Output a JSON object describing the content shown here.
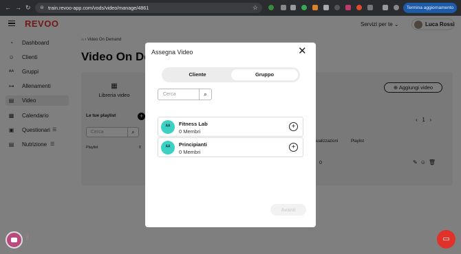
{
  "browser": {
    "url": "train.revoo-app.com/vods/video/manage/4861",
    "update_button": "Termina aggiornamento"
  },
  "header": {
    "logo": "REVOO",
    "services_label": "Servizi per te",
    "user_name": "Luca Rossi"
  },
  "sidebar": {
    "items": [
      {
        "label": "Dashboard",
        "icon": "gauge-icon"
      },
      {
        "label": "Clienti",
        "icon": "person-icon"
      },
      {
        "label": "Gruppi",
        "icon": "group-icon"
      },
      {
        "label": "Allenamenti",
        "icon": "dumbbell-icon"
      },
      {
        "label": "Video",
        "icon": "film-icon",
        "active": true
      },
      {
        "label": "Calendario",
        "icon": "calendar-icon"
      },
      {
        "label": "Questionari",
        "icon": "clipboard-icon"
      },
      {
        "label": "Nutrizione",
        "icon": "list-icon"
      }
    ]
  },
  "main": {
    "breadcrumb": "Video On Demand",
    "title": "Video On Demand",
    "library_label": "Libreria video",
    "playlists_label": "Le tue playlist",
    "search_placeholder": "Cerca",
    "playlist_col": "Playlist",
    "playlist_count": "0",
    "add_video_label": "Aggiungi video",
    "page_number": "1",
    "col_visualizzazioni": "Visualizzazioni",
    "col_playlist": "Playlist",
    "row_value": "0"
  },
  "modal": {
    "title": "Assegna Video",
    "tabs": [
      "Cliente",
      "Gruppo"
    ],
    "active_tab": "Gruppo",
    "search_placeholder": "Cerca",
    "groups": [
      {
        "name": "Fitness Lab",
        "members": "0 Membri"
      },
      {
        "name": "Principianti",
        "members": "0 Membri"
      }
    ],
    "next_button": "Avanti"
  },
  "colors": {
    "brand": "#e3342f",
    "group_avatar": "#3dd1c4",
    "chat_widget": "#e0312b"
  }
}
